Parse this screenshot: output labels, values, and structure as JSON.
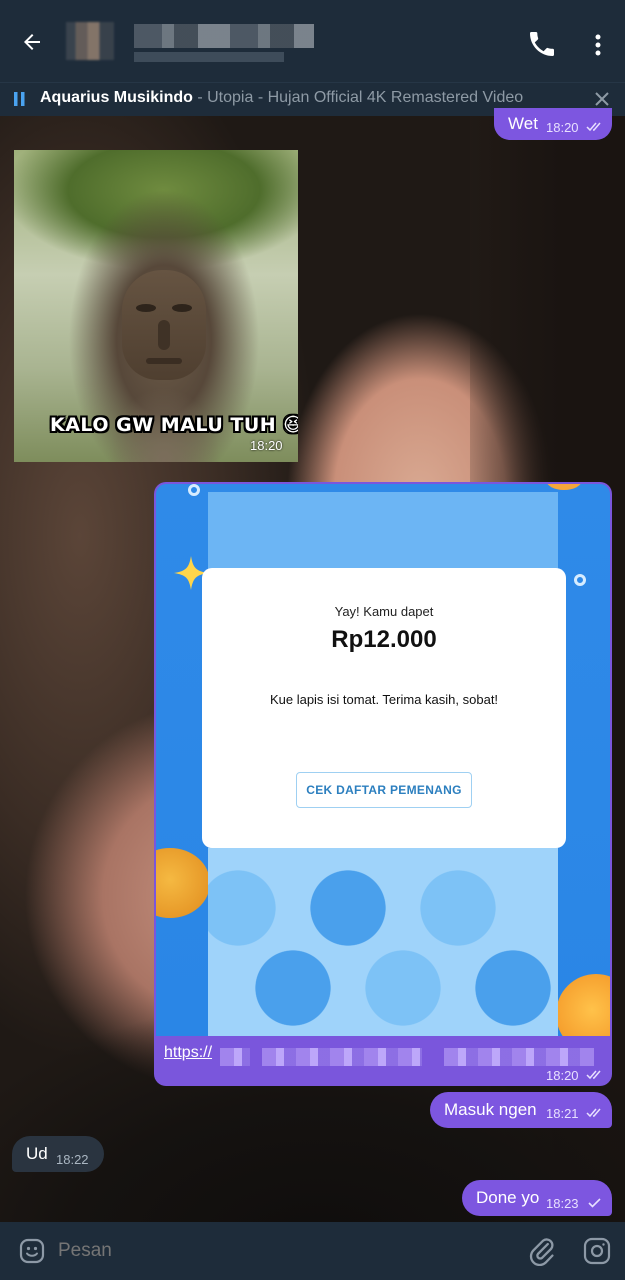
{
  "header": {
    "back_icon": "arrow-left-icon",
    "call_icon": "phone-icon",
    "more_icon": "more-vertical-icon"
  },
  "music": {
    "artist": "Aquarius Musikindo",
    "title": " - Utopia - Hujan  Official 4K Remastered Video"
  },
  "messages": {
    "m1": {
      "text": "Wet",
      "time": "18:20"
    },
    "sticker": {
      "caption": "KALO GW MALU TUH 😆",
      "time": "18:20"
    },
    "link": {
      "promo_head": "Yay! Kamu dapet",
      "promo_amount": "Rp12.000",
      "promo_msg": "Kue lapis isi tomat. Terima kasih, sobat!",
      "promo_button": "CEK DAFTAR PEMENANG",
      "url_prefix": "https://",
      "time": "18:20"
    },
    "m3": {
      "text": "Masuk ngen",
      "time": "18:21"
    },
    "m4": {
      "text": "Ud",
      "time": "18:22"
    },
    "m5": {
      "text": "Done yo",
      "time": "18:23"
    }
  },
  "input": {
    "placeholder": "Pesan"
  },
  "colors": {
    "outgoing_bubble": "#7d56e0",
    "incoming_bubble": "#2a3440",
    "bar": "#1e2c3a"
  }
}
